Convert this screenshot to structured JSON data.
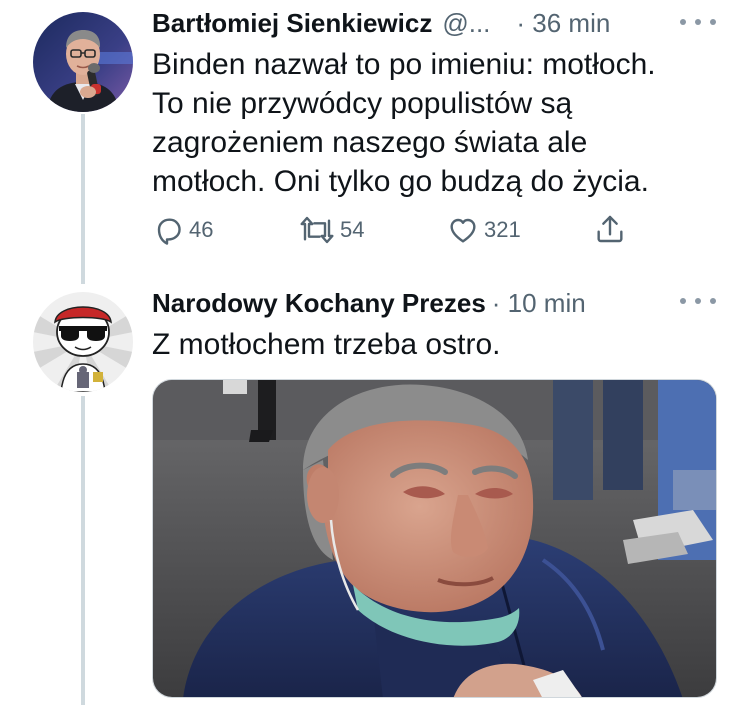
{
  "colors": {
    "text": "#0f1419",
    "secondary": "#536471",
    "thread_line": "#cfd9de"
  },
  "tweet1": {
    "author_name": "Bartłomiej Sienkiewicz",
    "handle": "@...",
    "time": "· 36 min",
    "text": "Binden nazwał to po imieniu: motłoch.\nTo nie przywódcy populistów są\nzagrożeniem naszego świata ale\nmotłoch. Oni tylko go budzą do życia.",
    "actions": {
      "reply_count": "46",
      "retweet_count": "54",
      "like_count": "321"
    },
    "icons": [
      "reply-icon",
      "retweet-icon",
      "like-icon",
      "share-icon",
      "more-icon"
    ]
  },
  "tweet2": {
    "author_name": "Narodowy Kochany Prezes",
    "time": "· 10 min",
    "text": "Z motłochem trzeba ostro.",
    "media": "photo of a crying older man in a dark blue puffer jacket with a face mask pulled down"
  }
}
